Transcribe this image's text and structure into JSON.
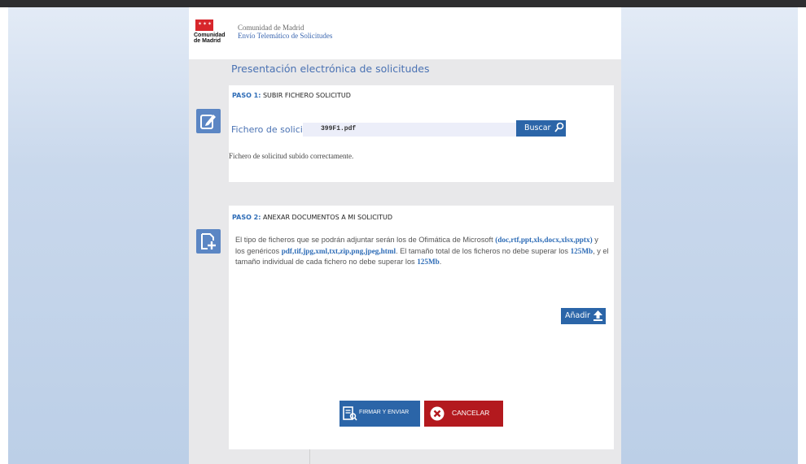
{
  "header": {
    "logo_text_line1": "Comunidad",
    "logo_text_line2": "de Madrid",
    "org_name": "Comunidad de Madrid",
    "service_name": "Envío Telemático de Solicitudes"
  },
  "page_title": "Presentación electrónica de solicitudes",
  "step1": {
    "label_prefix": "PASO 1:",
    "label_text": " SUBIR FICHERO SOLICITUD",
    "file_label": "Fichero de solicitud",
    "file_value": "399F1.pdf",
    "browse_button": "Buscar",
    "status_message": "Fichero de solicitud subido correctamente."
  },
  "step2": {
    "label_prefix": "PASO 2:",
    "label_text": " ANEXAR DOCUMENTOS A MI SOLICITUD",
    "desc_part1": "El tipo de ficheros que se podrán adjuntar serán los de Ofimática de Microsoft ",
    "desc_ms_types": "(doc,rtf,ppt,xls,docx,xlsx,pptx)",
    "desc_part2": " y los genéricos ",
    "desc_generic_types": "pdf,tif,jpg,xml,txt,zip,png,jpeg,html",
    "desc_part3": ". El tamaño total de los ficheros no debe superar los ",
    "desc_total_size": "125Mb",
    "desc_part4": ", y el tamaño individual de cada fichero no debe superar los ",
    "desc_individual_size": "125Mb",
    "desc_part5": ".",
    "add_button": "Añadir"
  },
  "actions": {
    "sign_send": "FIRMAR Y ENVIAR",
    "cancel": "CANCELAR"
  },
  "colors": {
    "accent_blue": "#2b65a8",
    "title_blue": "#4a72b3",
    "cancel_red": "#b3191e",
    "brand_red": "#d7262b"
  },
  "icons": {
    "step1": "edit-document-icon",
    "step2": "add-document-icon",
    "browse": "search-icon",
    "add": "upload-icon",
    "sign": "sign-document-icon",
    "cancel": "cancel-icon"
  }
}
